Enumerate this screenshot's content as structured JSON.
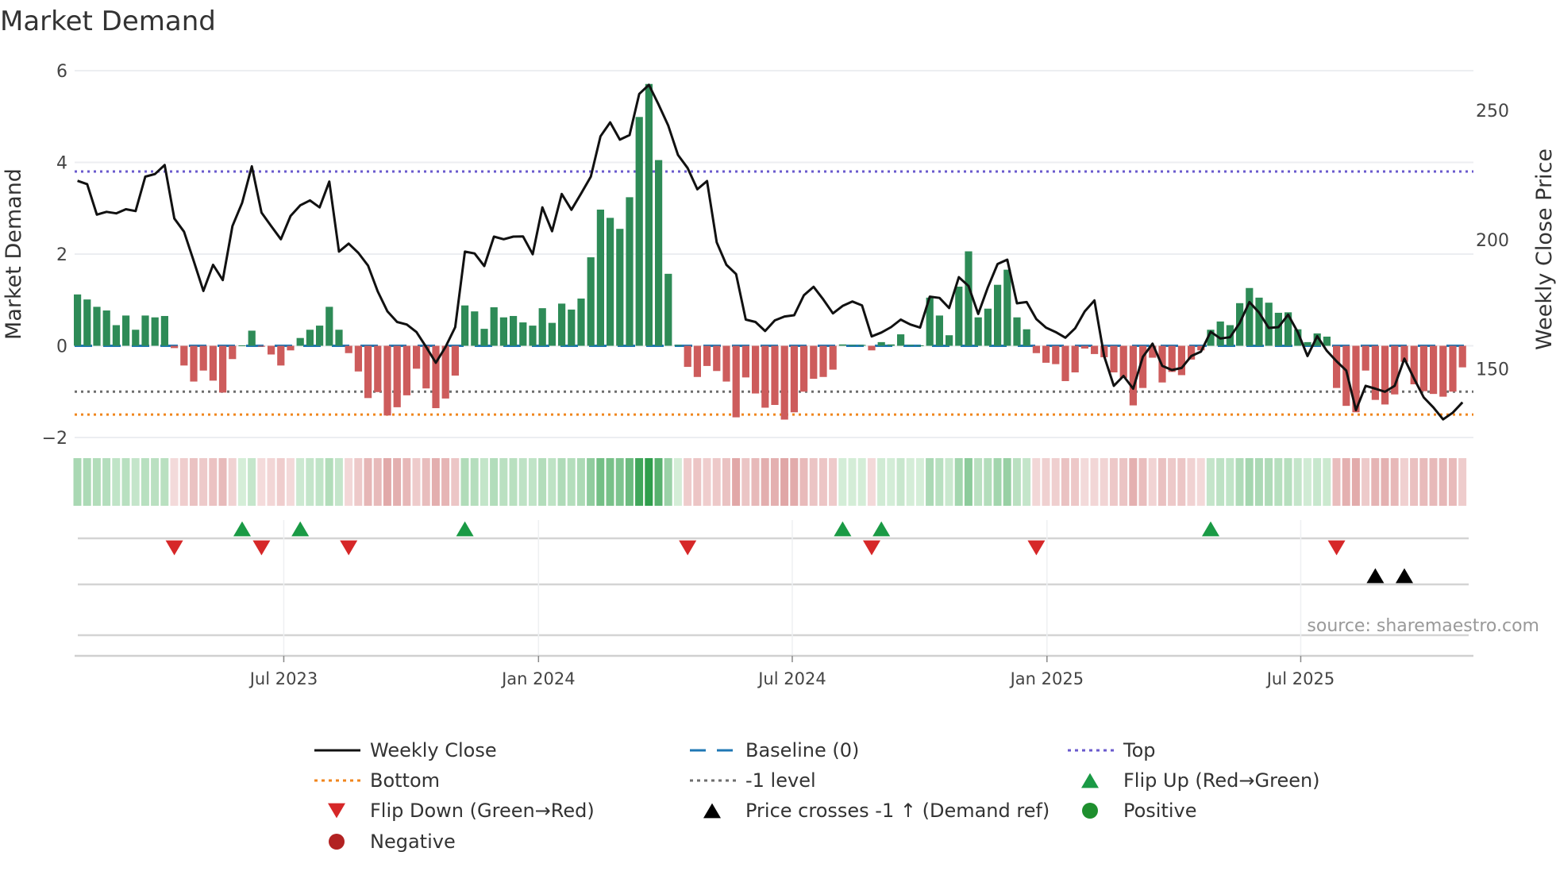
{
  "title": "Market Demand",
  "source": "source: sharemaestro.com",
  "colors": {
    "positive_bar": "#2e8b57",
    "negative_bar": "#cd5c5c",
    "price_line": "#111111",
    "top_line": "#6a5acd",
    "bottom_line": "#f0861e",
    "minus1_line": "#6e6e6e",
    "baseline": "#1f77b4",
    "flip_up": "#1a9a45",
    "flip_down": "#d62728",
    "cross": "#000000",
    "positive_dot": "#1e8f2e",
    "negative_dot": "#b22222"
  },
  "chart_data": {
    "type": "bar",
    "title": "Market Demand",
    "ylabel": "Market Demand",
    "y2label": "Weekly Close Price",
    "ylim": [
      -2,
      6
    ],
    "y2lim": [
      123.5,
      265.4
    ],
    "yticks": [
      "6",
      "4",
      "2",
      "0",
      "−2"
    ],
    "ytick_values": [
      6,
      4,
      2,
      0,
      -2
    ],
    "y2ticks": [
      "250",
      "200",
      "150"
    ],
    "y2tick_values": [
      250,
      200,
      150
    ],
    "n_weeks": 144,
    "x_ticks": [
      {
        "label": "Jul 2023",
        "week": 22.3
      },
      {
        "label": "Jan 2024",
        "week": 48.6
      },
      {
        "label": "Jul 2024",
        "week": 74.8
      },
      {
        "label": "Jan 2025",
        "week": 101.1
      },
      {
        "label": "Jul 2025",
        "week": 127.3
      }
    ],
    "demand": [
      1.12,
      1.01,
      0.85,
      0.77,
      0.45,
      0.66,
      0.35,
      0.66,
      0.62,
      0.65,
      -0.05,
      -0.43,
      -0.78,
      -0.54,
      -0.76,
      -1.02,
      -0.29,
      0.01,
      0.33,
      -0.02,
      -0.19,
      -0.43,
      -0.1,
      0.17,
      0.35,
      0.44,
      0.85,
      0.35,
      -0.16,
      -0.56,
      -1.14,
      -1.01,
      -1.52,
      -1.34,
      -1.08,
      -0.5,
      -0.93,
      -1.36,
      -1.15,
      -0.65,
      0.88,
      0.75,
      0.37,
      0.84,
      0.62,
      0.65,
      0.51,
      0.44,
      0.82,
      0.5,
      0.92,
      0.79,
      1.03,
      1.93,
      2.97,
      2.79,
      2.55,
      3.24,
      4.99,
      5.71,
      4.05,
      1.57,
      0.02,
      -0.46,
      -0.68,
      -0.44,
      -0.55,
      -0.78,
      -1.56,
      -0.69,
      -1.04,
      -1.35,
      -1.29,
      -1.61,
      -1.45,
      -1.0,
      -0.72,
      -0.68,
      -0.52,
      0.03,
      0.02,
      0.02,
      -0.1,
      0.08,
      0.03,
      0.25,
      0.02,
      0.01,
      1.05,
      0.66,
      0.23,
      1.29,
      2.06,
      0.62,
      0.81,
      1.33,
      1.66,
      0.62,
      0.36,
      -0.16,
      -0.37,
      -0.4,
      -0.77,
      -0.58,
      -0.06,
      -0.18,
      -0.25,
      -0.58,
      -0.7,
      -1.3,
      -0.92,
      -0.26,
      -0.8,
      -0.57,
      -0.64,
      -0.3,
      -0.1,
      0.35,
      0.53,
      0.45,
      0.93,
      1.26,
      1.05,
      0.94,
      0.72,
      0.73,
      0.36,
      0.08,
      0.27,
      0.2,
      -0.92,
      -1.31,
      -1.45,
      -0.54,
      -1.18,
      -1.28,
      -1.06,
      -0.35,
      -0.84,
      -0.99,
      -1.05,
      -1.11,
      -1.0,
      -0.47
    ],
    "weekly_close": [
      222.8,
      221.5,
      209.7,
      210.8,
      210.2,
      211.8,
      211.1,
      224.4,
      225.4,
      228.9,
      208.2,
      203.1,
      191.8,
      180.2,
      190.3,
      184.4,
      205.3,
      214.3,
      228.4,
      210.5,
      205.3,
      200.2,
      209.2,
      213.3,
      215.2,
      212.5,
      222.5,
      195.4,
      198.5,
      194.9,
      190.0,
      180.0,
      172.3,
      168.2,
      167.2,
      164.3,
      158.5,
      152.4,
      158.5,
      166.2,
      195.4,
      194.7,
      189.8,
      201.2,
      200.2,
      201.2,
      201.3,
      194.4,
      212.5,
      203.3,
      217.7,
      211.6,
      217.9,
      224.4,
      240.0,
      245.4,
      238.7,
      240.5,
      256.4,
      259.9,
      252.3,
      244.1,
      232.8,
      227.7,
      219.5,
      222.7,
      199.0,
      190.3,
      186.7,
      169.1,
      168.2,
      164.7,
      168.8,
      170.3,
      170.8,
      178.5,
      181.8,
      176.9,
      171.5,
      174.4,
      176.1,
      174.6,
      162.6,
      164.1,
      166.2,
      169.1,
      167.2,
      166.0,
      178.0,
      177.5,
      173.6,
      185.5,
      182.1,
      171.3,
      181.6,
      190.6,
      192.3,
      175.4,
      175.9,
      169.3,
      166.0,
      164.3,
      162.1,
      165.7,
      172.3,
      176.5,
      155.0,
      143.5,
      147.3,
      142.4,
      154.7,
      159.8,
      151.2,
      149.6,
      150.4,
      155.0,
      156.7,
      164.4,
      161.8,
      162.3,
      167.8,
      175.9,
      171.8,
      165.9,
      166.2,
      171.0,
      164.2,
      155.0,
      162.7,
      157.0,
      153.0,
      149.4,
      134.1,
      143.5,
      142.4,
      141.2,
      143.5,
      154.0,
      146.3,
      139.0,
      135.1,
      130.5,
      133.1,
      137.1
    ],
    "reference_lines": {
      "top": 3.8,
      "baseline": 0,
      "minus1": -1,
      "bottom": -1.5
    },
    "flip_up_weeks": [
      18,
      24,
      41,
      80,
      84,
      118
    ],
    "flip_down_weeks": [
      11,
      20,
      29,
      64,
      83,
      100,
      131
    ],
    "price_cross_weeks": [
      135,
      138
    ]
  },
  "legend": [
    {
      "label": "Weekly Close",
      "type": "line-solid",
      "color": "#111111"
    },
    {
      "label": "Baseline (0)",
      "type": "line-dash",
      "color": "#1f77b4"
    },
    {
      "label": "Top",
      "type": "line-dot",
      "color": "#6a5acd"
    },
    {
      "label": "Bottom",
      "type": "line-dot",
      "color": "#f0861e"
    },
    {
      "label": "-1 level",
      "type": "line-dot",
      "color": "#6e6e6e"
    },
    {
      "label": "Flip Up (Red→Green)",
      "type": "tri-up",
      "color": "#1a9a45"
    },
    {
      "label": "Flip Down (Green→Red)",
      "type": "tri-down",
      "color": "#d62728"
    },
    {
      "label": "Price crosses -1 ↑ (Demand ref)",
      "type": "tri-up",
      "color": "#000000"
    },
    {
      "label": "Positive",
      "type": "dot",
      "color": "#1e8f2e"
    },
    {
      "label": "Negative",
      "type": "dot",
      "color": "#b22222"
    }
  ]
}
